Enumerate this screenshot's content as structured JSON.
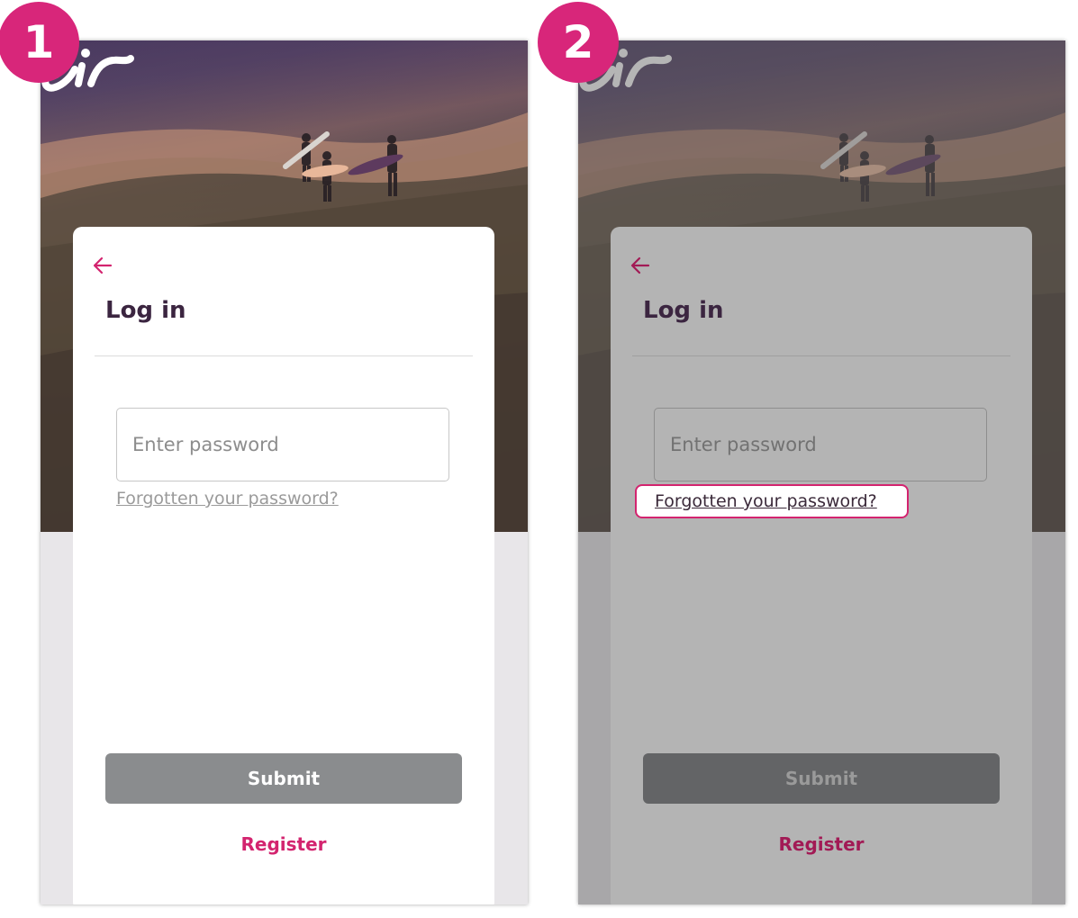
{
  "steps": [
    {
      "number": "1",
      "logo_text": "eir",
      "title": "Log in",
      "password_placeholder": "Enter password",
      "forgot_link": "Forgotten your password?",
      "submit_label": "Submit",
      "register_label": "Register"
    },
    {
      "number": "2",
      "logo_text": "eir",
      "title": "Log in",
      "password_placeholder": "Enter password",
      "forgot_link": "Forgotten your password?",
      "submit_label": "Submit",
      "register_label": "Register"
    }
  ],
  "colors": {
    "brand_pink": "#d8267a",
    "title_text": "#3b2540",
    "submit_disabled": "#8a8c8e"
  },
  "icons": [
    "back-arrow-icon",
    "eir-logo-icon"
  ]
}
